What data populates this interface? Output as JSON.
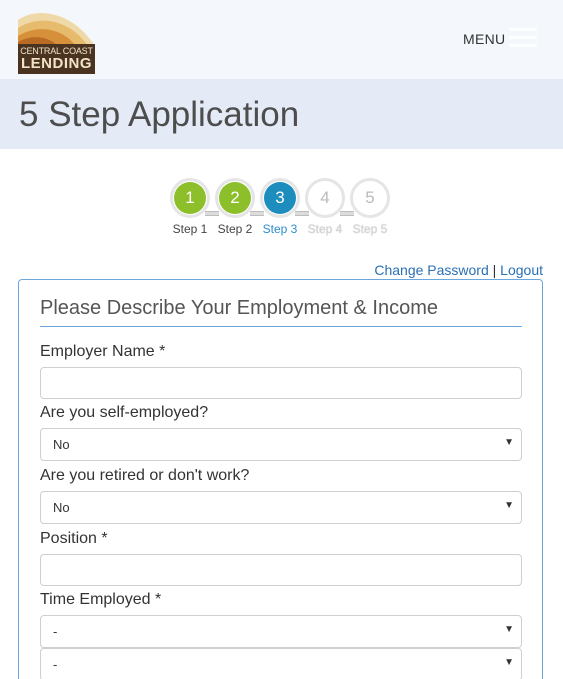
{
  "header": {
    "logo": {
      "line1": "CENTRAL COAST",
      "line2": "LENDING"
    },
    "menu_label": "MENU"
  },
  "page_title": "5 Step Application",
  "steps": [
    {
      "number": "1",
      "label": "Step 1",
      "state": "done"
    },
    {
      "number": "2",
      "label": "Step 2",
      "state": "done"
    },
    {
      "number": "3",
      "label": "Step 3",
      "state": "active"
    },
    {
      "number": "4",
      "label": "Step 4",
      "state": "todo"
    },
    {
      "number": "5",
      "label": "Step 5",
      "state": "todo"
    }
  ],
  "account": {
    "change_password": "Change Password",
    "separator": "|",
    "logout": "Logout"
  },
  "form": {
    "title": "Please Describe Your Employment & Income",
    "employer_name": {
      "label": "Employer Name *",
      "value": ""
    },
    "self_employed": {
      "label": "Are you self-employed?",
      "value": "No"
    },
    "retired": {
      "label": "Are you retired or don't work?",
      "value": "No"
    },
    "position": {
      "label": "Position *",
      "value": ""
    },
    "time_employed": {
      "label": "Time Employed *",
      "years_value": "-",
      "months_value": "-"
    }
  },
  "colors": {
    "step_done": "#8cbf2a",
    "step_active": "#1c8dbd",
    "link": "#2a6fb6",
    "panel_border": "#6aa7dc",
    "title_band": "#e4ebf7"
  },
  "icons": {
    "select_arrow": "caret-down-icon",
    "menu": "hamburger-icon"
  }
}
